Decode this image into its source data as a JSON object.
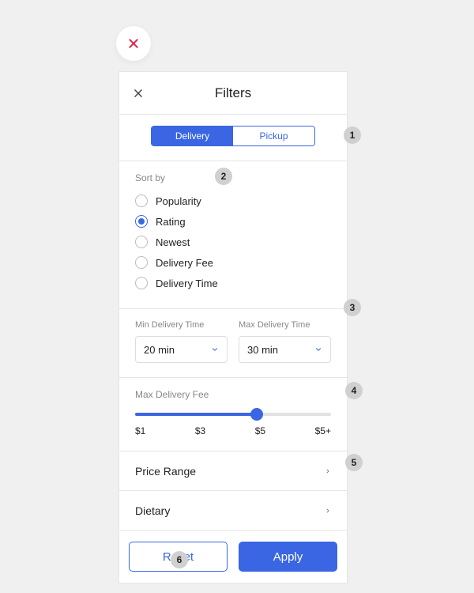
{
  "header": {
    "title": "Filters"
  },
  "segmented": {
    "items": [
      "Delivery",
      "Pickup"
    ],
    "active_index": 0
  },
  "sort": {
    "label": "Sort by",
    "options": [
      "Popularity",
      "Rating",
      "Newest",
      "Delivery Fee",
      "Delivery Time"
    ],
    "selected_index": 1
  },
  "delivery_time": {
    "min_label": "Min Delivery Time",
    "min_value": "20 min",
    "max_label": "Max Delivery Time",
    "max_value": "30 min"
  },
  "fee": {
    "label": "Max Delivery Fee",
    "ticks": [
      "$1",
      "$3",
      "$5",
      "$5+"
    ],
    "value_index": 2,
    "fill_percent": 62
  },
  "nav": {
    "price_range": "Price Range",
    "dietary": "Dietary"
  },
  "footer": {
    "reset": "Reset",
    "apply": "Apply"
  },
  "annotations": {
    "a1": "1",
    "a2": "2",
    "a3": "3",
    "a4": "4",
    "a5": "5",
    "a6": "6"
  },
  "colors": {
    "accent": "#3a66e3",
    "fab_close": "#e02448"
  }
}
